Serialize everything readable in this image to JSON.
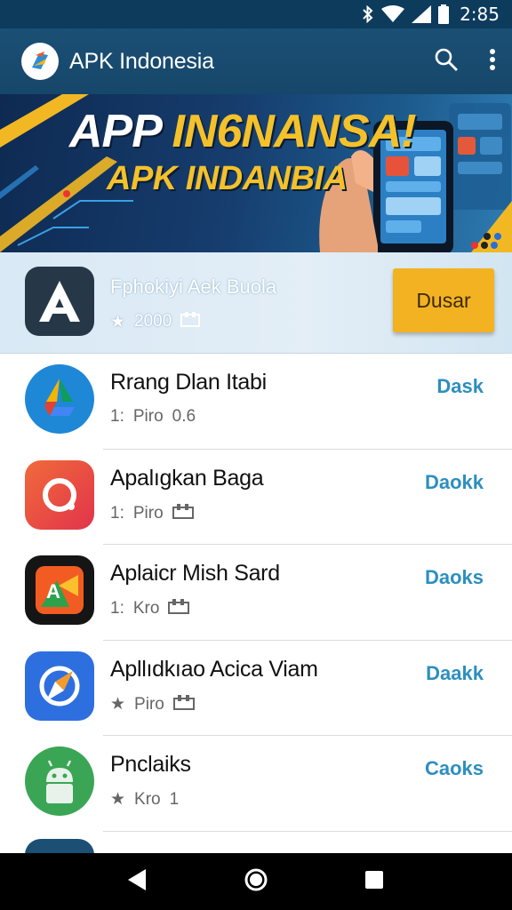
{
  "status_bar": {
    "time": "2:85",
    "icons": [
      "bluetooth-icon",
      "wifi-icon",
      "signal-icon",
      "battery-icon"
    ]
  },
  "app_bar": {
    "title": "APK Indonesia",
    "icons": [
      "app-logo-icon",
      "search-icon",
      "more-vert-icon"
    ]
  },
  "banner": {
    "line1_white": "APP ",
    "line1_yellow": "IN6NANSA!",
    "line2": "APK INDANBIA"
  },
  "featured": {
    "name": "Fphokiyi Aek Buola",
    "rating": "2000",
    "button_label": "Dusar",
    "icon": "letter-a-icon"
  },
  "apps": [
    {
      "name": "Rrang Dlan Itabi",
      "meta_a": "1:",
      "meta_b": "Piro",
      "meta_c": "0.6",
      "action": "Dask",
      "icon": "drive-icon"
    },
    {
      "name": "Apalıgkan Baga",
      "meta_a": "1:",
      "meta_b": "Piro",
      "meta_c": "",
      "action": "Daokk",
      "icon": "ring-icon"
    },
    {
      "name": "Aplaicr Mish Sard",
      "meta_a": "1:",
      "meta_b": "Kro",
      "meta_c": "",
      "action": "Daoks",
      "icon": "gallery-icon"
    },
    {
      "name": "Apllıdkıao Acica Viam",
      "meta_a": "",
      "meta_b": "Piro",
      "meta_c": "",
      "action": "Daakk",
      "icon": "compass-icon"
    },
    {
      "name": "Pnclaiks",
      "meta_a": "",
      "meta_b": "Kro",
      "meta_c": "1",
      "action": "Caoks",
      "icon": "android-icon"
    }
  ],
  "colors": {
    "status_bar": "#0d3b5c",
    "app_bar": "#1b4f74",
    "accent_button": "#f3b221",
    "action_text": "#2d8fbf"
  }
}
